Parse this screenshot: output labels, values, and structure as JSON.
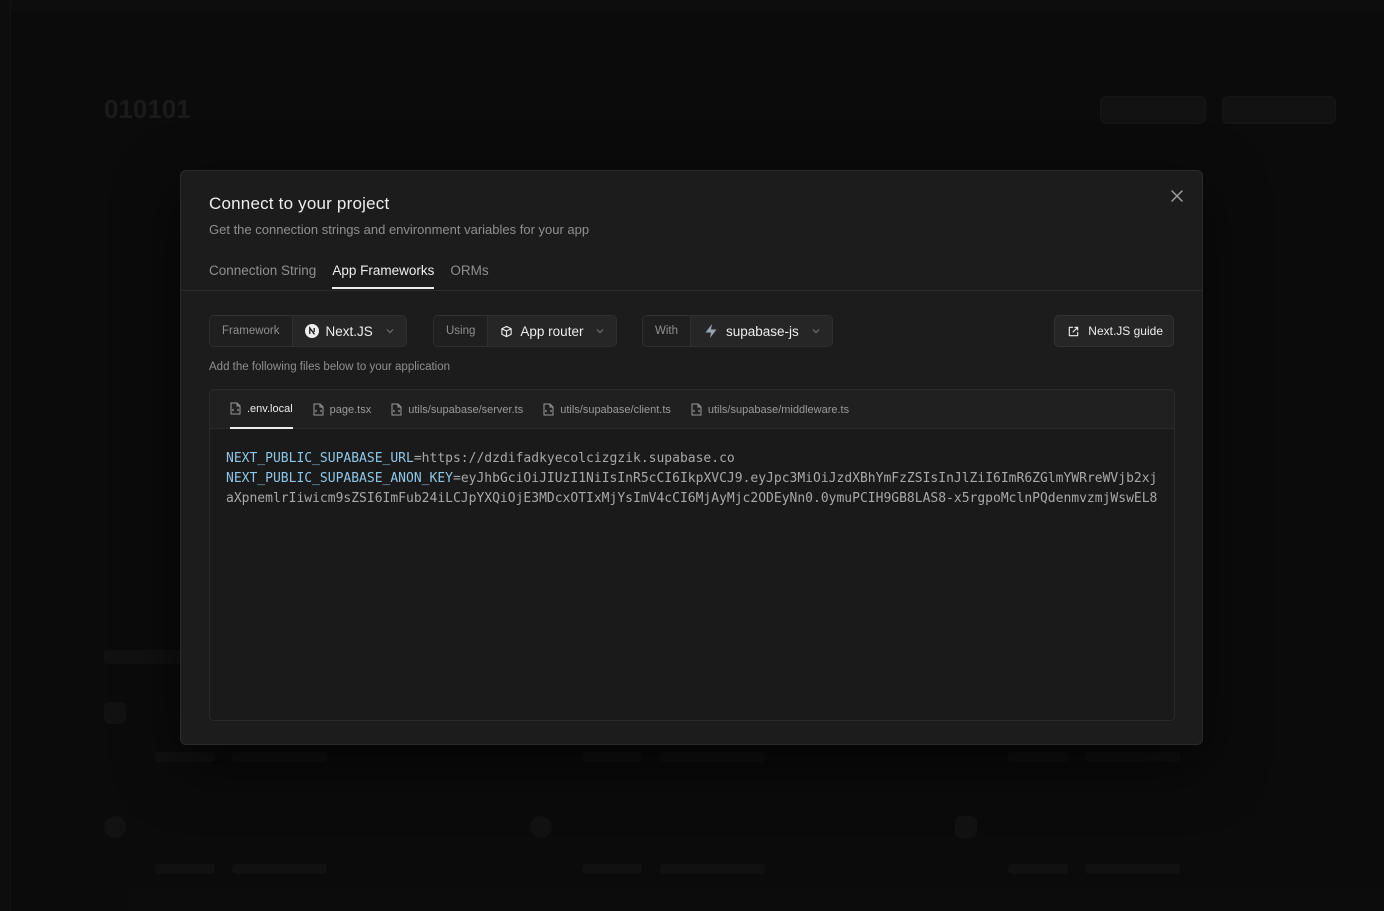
{
  "background": {
    "project_title": "010101"
  },
  "modal": {
    "title": "Connect to your project",
    "subtitle": "Get the connection strings and environment variables for your app",
    "close_icon": "close-icon",
    "tabs": [
      {
        "label": "Connection String",
        "active": false
      },
      {
        "label": "App Frameworks",
        "active": true
      },
      {
        "label": "ORMs",
        "active": false
      }
    ],
    "framework": {
      "label": "Framework",
      "value": "Next.JS",
      "icon": "nextjs-icon"
    },
    "using": {
      "label": "Using",
      "value": "App router",
      "icon": "box-icon"
    },
    "with": {
      "label": "With",
      "value": "supabase-js",
      "icon": "supabase-icon"
    },
    "guide_button": "Next.JS guide",
    "hint": "Add the following files below to your application",
    "files": [
      {
        "name": ".env.local",
        "active": true
      },
      {
        "name": "page.tsx",
        "active": false
      },
      {
        "name": "utils/supabase/server.ts",
        "active": false
      },
      {
        "name": "utils/supabase/client.ts",
        "active": false
      },
      {
        "name": "utils/supabase/middleware.ts",
        "active": false
      }
    ],
    "code": {
      "url_key": "NEXT_PUBLIC_SUPABASE_URL",
      "url_value": "https://dzdifadkyecolcizgzik.supabase.co",
      "anon_key": "NEXT_PUBLIC_SUPABASE_ANON_KEY",
      "anon_value": "eyJhbGciOiJIUzI1NiIsInR5cCI6IkpXVCJ9.eyJpc3MiOiJzdXBhYmFzZSIsInJlZiI6ImR6ZGlmYWRreWVjb2xjaXpnemlrIiwicm9sZSI6ImFub24iLCJpYXQiOjE3MDcxOTIxMjYsImV4cCI6MjAyMjc2ODEyNn0.0ymuPCIH9GB8LAS8-x5rgpoMclnPQdenmvzmjWswEL8"
    },
    "colors": {
      "modal_bg": "#1c1c1c",
      "env_key": "#8dc7e8",
      "env_value": "#a8a8a8"
    }
  }
}
